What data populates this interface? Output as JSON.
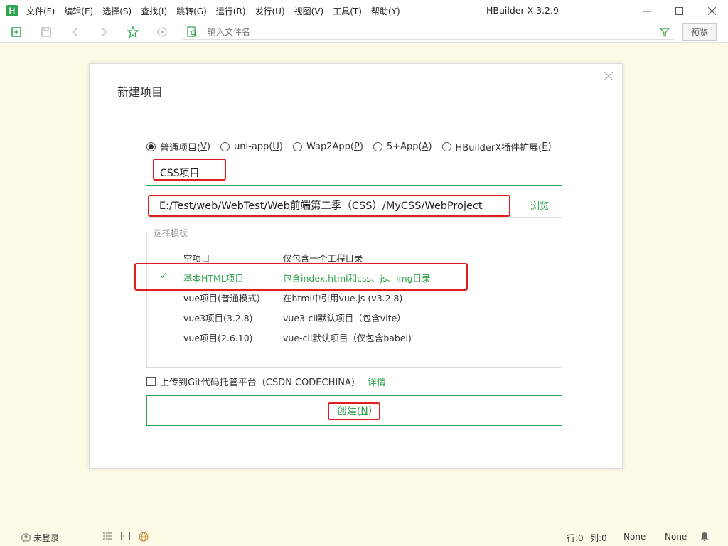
{
  "app": {
    "logo": "H",
    "title": "HBuilder X 3.2.9",
    "menu": [
      "文件(F)",
      "编辑(E)",
      "选择(S)",
      "查找(I)",
      "跳转(G)",
      "运行(R)",
      "发行(U)",
      "视图(V)",
      "工具(T)",
      "帮助(Y)"
    ]
  },
  "toolbar": {
    "file_input_placeholder": "输入文件名",
    "preview_label": "预览"
  },
  "dialog": {
    "title": "新建项目",
    "radios": [
      {
        "label": "普通项目(",
        "key": "V",
        "checked": true
      },
      {
        "label": "uni-app(",
        "key": "U",
        "checked": false
      },
      {
        "label": "Wap2App(",
        "key": "P",
        "checked": false
      },
      {
        "label": "5+App(",
        "key": "A",
        "checked": false
      },
      {
        "label": "HBuilderX插件扩展(",
        "key": "E",
        "checked": false
      }
    ],
    "project_name": "CSS项目",
    "project_path": "E:/Test/web/WebTest/Web前端第二季（CSS）/MyCSS/WebProject",
    "browse_label": "浏览",
    "template_legend": "选择模板",
    "templates": [
      {
        "name": "空项目",
        "desc": "仅包含一个工程目录",
        "selected": false
      },
      {
        "name": "基本HTML项目",
        "desc": "包含index.html和css、js、img目录",
        "selected": true
      },
      {
        "name": "vue项目(普通模式)",
        "desc": "在html中引用vue.js (v3.2.8)",
        "selected": false
      },
      {
        "name": "vue3项目(3.2.8)",
        "desc": "vue3-cli默认项目（包含vite）",
        "selected": false
      },
      {
        "name": "vue项目(2.6.10)",
        "desc": "vue-cli默认项目（仅包含babel)",
        "selected": false
      }
    ],
    "git_label": "上传到Git代码托管平台（CSDN CODECHINA）",
    "git_detail": "详情",
    "create_label": "创建(",
    "create_key": "N"
  },
  "statusbar": {
    "login": "未登录",
    "row": "行:0",
    "col": "列:0",
    "enc1": "None",
    "enc2": "None"
  },
  "colors": {
    "accent": "#2fa44f",
    "highlight_box": "#e02020",
    "background": "#fefae8"
  }
}
